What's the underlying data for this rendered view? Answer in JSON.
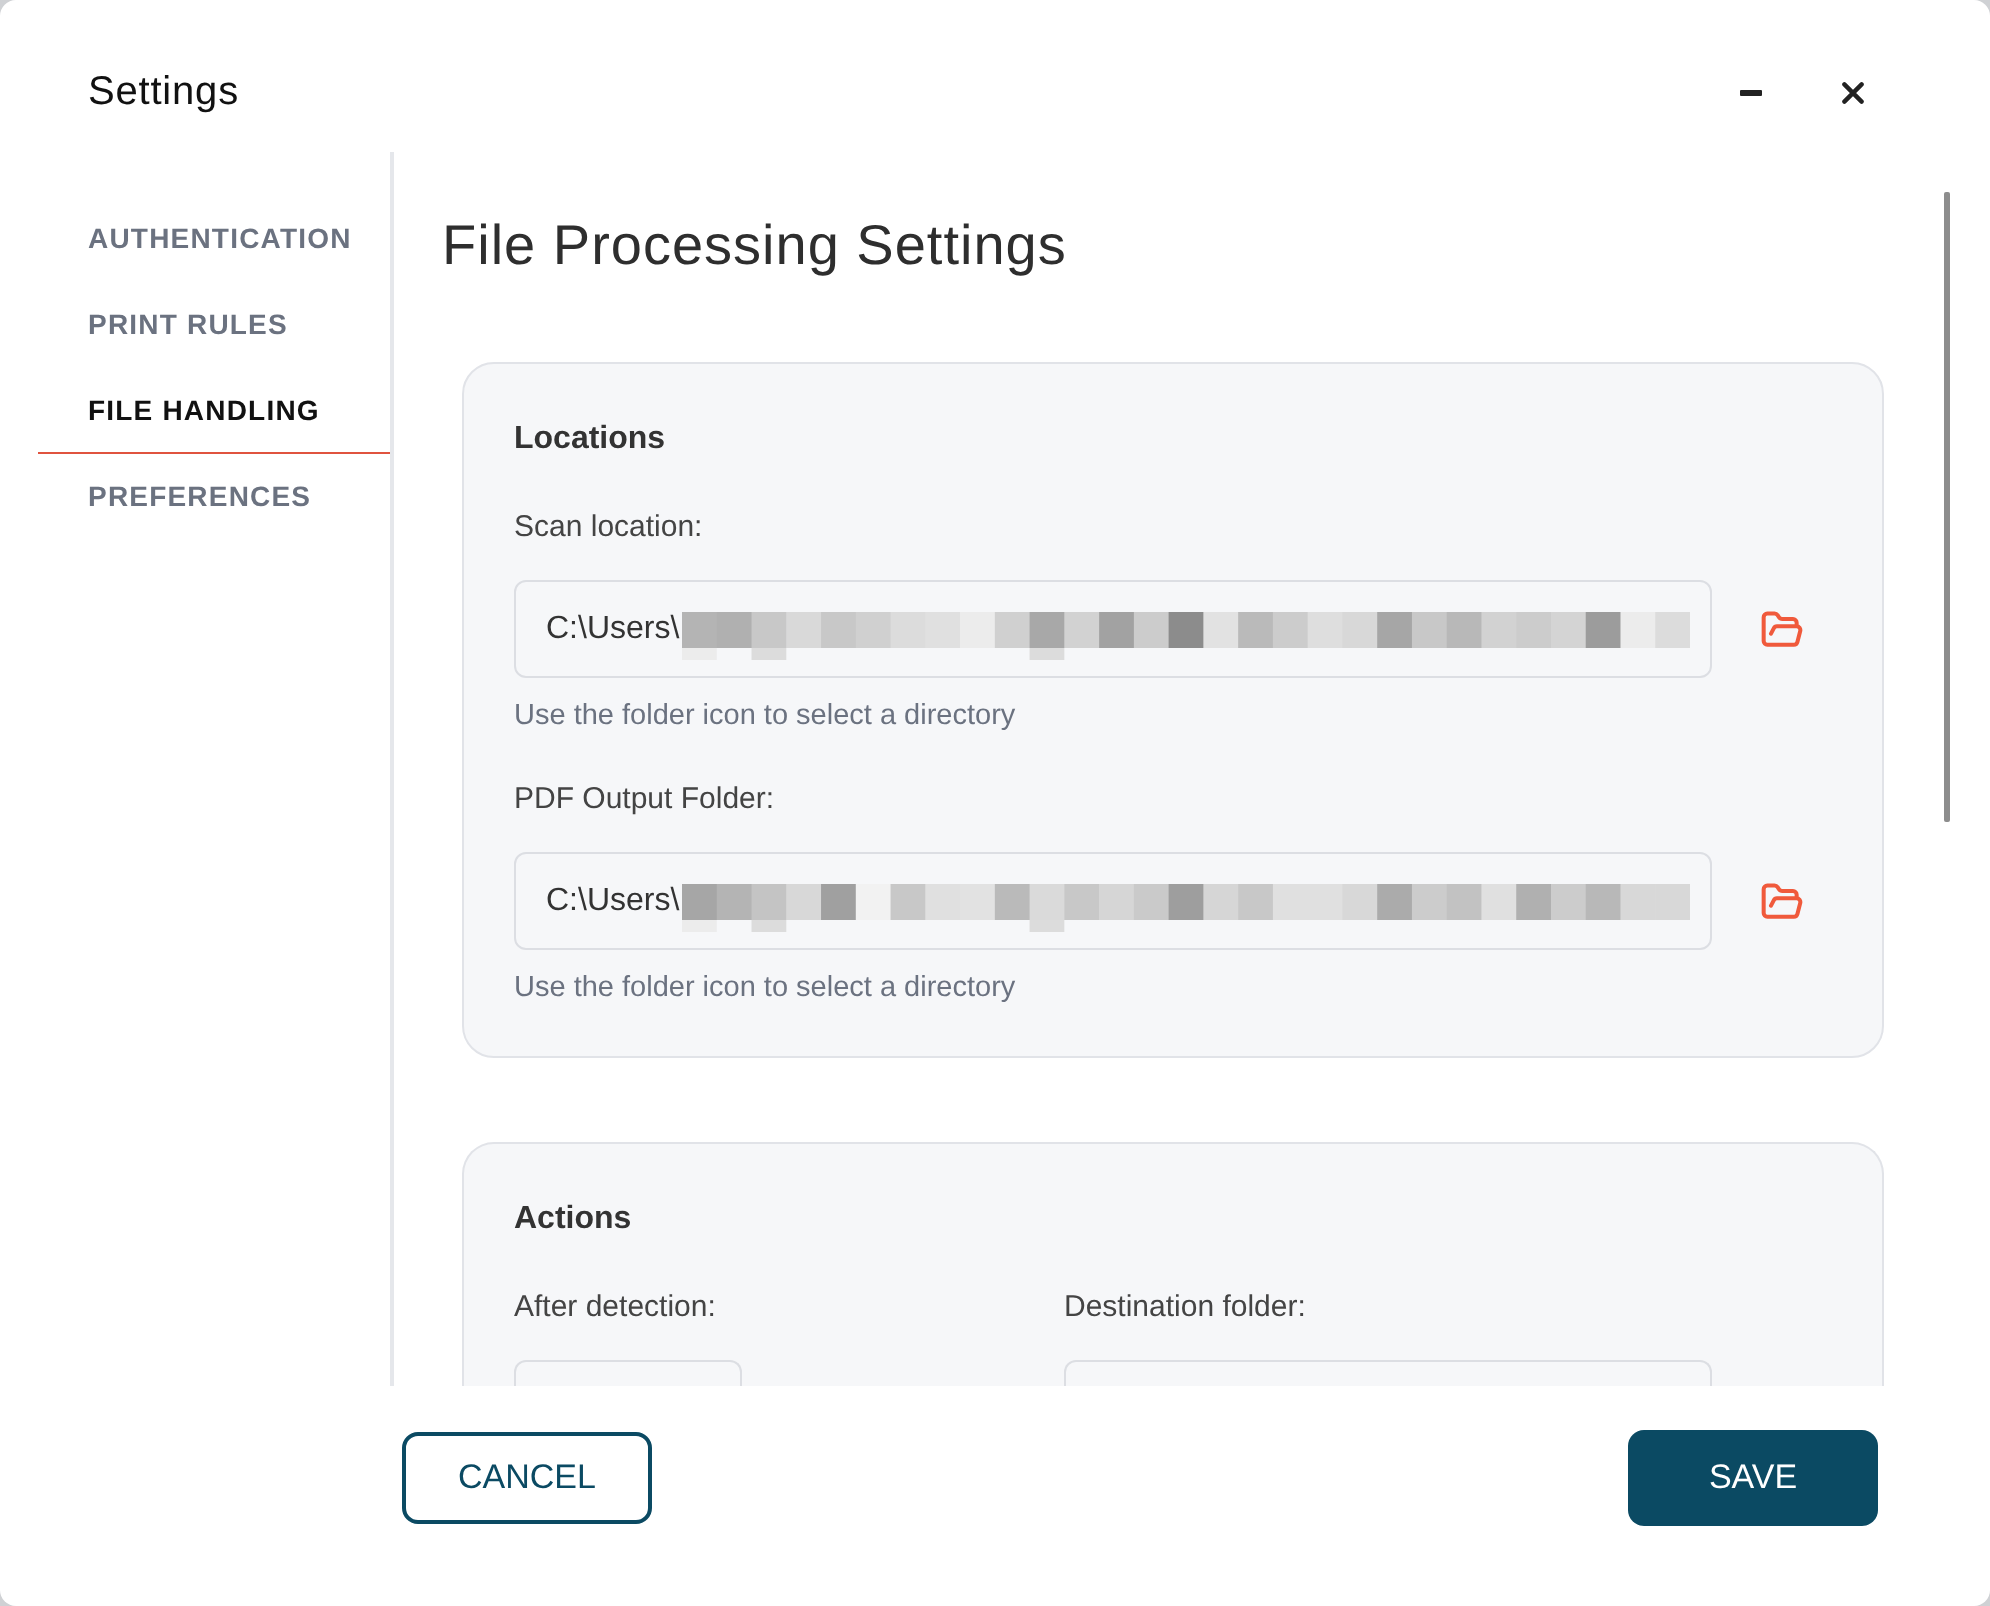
{
  "window": {
    "title": "Settings"
  },
  "sidebar": {
    "items": [
      {
        "label": "AUTHENTICATION",
        "selected": false
      },
      {
        "label": "PRINT RULES",
        "selected": false
      },
      {
        "label": "FILE HANDLING",
        "selected": true
      },
      {
        "label": "PREFERENCES",
        "selected": false
      }
    ]
  },
  "page": {
    "title": "File Processing Settings"
  },
  "sections": [
    {
      "title": "Locations",
      "kind": "stacked",
      "fields": [
        {
          "kind": "path",
          "label": "Scan location:",
          "value": "C:\\Users\\",
          "redacted": true,
          "help": "Use the folder icon to select a directory"
        },
        {
          "kind": "path",
          "label": "PDF Output Folder:",
          "value": "C:\\Users\\",
          "redacted": true,
          "help": "Use the folder icon to select a directory"
        }
      ]
    },
    {
      "title": "Actions",
      "kind": "columns",
      "fields": [
        {
          "kind": "short",
          "label": "After detection:"
        },
        {
          "kind": "long",
          "label": "Destination folder:"
        }
      ]
    }
  ],
  "buttons": [
    {
      "label": "CANCEL",
      "kind": "outline"
    },
    {
      "label": "SAVE",
      "kind": "filled"
    }
  ]
}
